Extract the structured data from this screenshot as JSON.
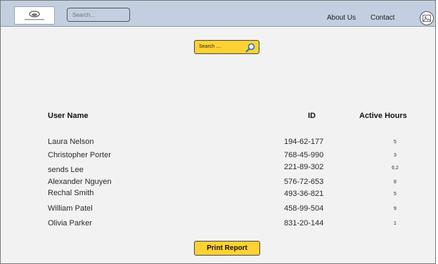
{
  "header": {
    "search_placeholder": "Search...",
    "nav": {
      "about": "About Us",
      "contact": "Contact"
    }
  },
  "main": {
    "search_label": "Search ....",
    "table": {
      "columns": {
        "user": "User Name",
        "id": "ID",
        "hours": "Active Hours"
      },
      "rows": [
        {
          "name": "Laura Nelson",
          "id": "194-62-177",
          "hours": "5"
        },
        {
          "name": "Christopher Porter",
          "id": "768-45-990",
          "hours": "3"
        },
        {
          "name": "sends Lee",
          "id": "221-89-302",
          "hours": "6.2"
        },
        {
          "name": "Alexander Nguyen",
          "id": "576-72-653",
          "hours": "8"
        },
        {
          "name": "Rechal Smith",
          "id": "493-36-821",
          "hours": "5"
        },
        {
          "name": "William Patel",
          "id": "458-99-504",
          "hours": "9"
        },
        {
          "name": "Olivia Parker",
          "id": "831-20-144",
          "hours": "1"
        }
      ]
    },
    "print_label": "Print Report"
  },
  "colors": {
    "topbar": "#c3cfe0",
    "accent_button": "#ffd233",
    "page_background": "#f2f2f2"
  },
  "icons": {
    "logo": "company-logo",
    "search": "magnifier-icon",
    "avatar": "user-avatar-icon"
  }
}
